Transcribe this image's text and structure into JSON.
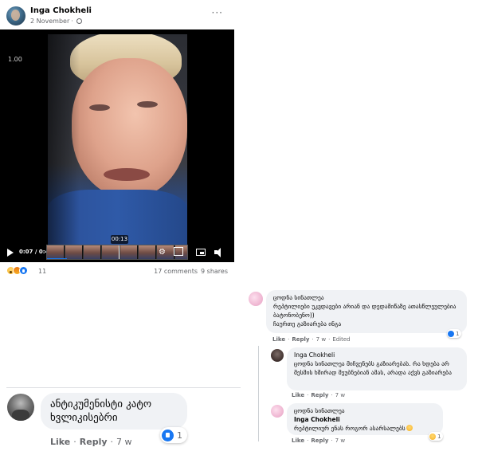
{
  "post": {
    "author": "Inga Chokheli",
    "date": "2 November",
    "separator": "·",
    "more": "···",
    "video": {
      "speed_label": "1.00",
      "preview_time": "00:13",
      "current_time": "0:07",
      "duration": "0:49",
      "time_separator": " / ",
      "progress_fraction": 0.14
    },
    "reactions_count": "11",
    "comments_label": "17 comments",
    "shares_label": "9 shares"
  },
  "left_comment": {
    "text": "ანტიკუმენისტი კატო ხვლიკისებრი",
    "like_label": "Like",
    "reply_label": "Reply",
    "time": "7 w",
    "separator": "·",
    "reaction_count": "1"
  },
  "thread": {
    "comment1": {
      "name": "ცოდნა სინათლეა",
      "text": "რეპტილიები უკვდავები არიან და დედამიწაზე ათასწლეულებია ბატონობენო))",
      "text2": "ჩაურთე გაზიარება ინგა",
      "like_label": "Like",
      "reply_label": "Reply",
      "time": "7 w",
      "edited": "Edited",
      "reaction_count": "1"
    },
    "comment2": {
      "name": "Inga Chokheli",
      "text": "ცოდნა სინათლეა მიჩვენებს გაზიარებას. რა ხდება არ მესმის ხშირად მეუბნებიან ამას, არადა აქვს გაზიარება",
      "like_label": "Like",
      "reply_label": "Reply",
      "time": "7 w"
    },
    "comment3": {
      "name": "ცოდნა სინათლეა",
      "mention": "Inga Chokheli",
      "text": "რეპტილიურ ენას როგორ ასარსალებს",
      "like_label": "Like",
      "reply_label": "Reply",
      "time": "7 w",
      "reaction_count": "1"
    }
  },
  "colors": {
    "accent": "#1877f2",
    "bubble": "#f0f2f5",
    "meta_text": "#65676b"
  },
  "icons": [
    "globe-icon",
    "more-icon",
    "play-icon",
    "settings-icon",
    "pip-icon",
    "volume-icon",
    "like-icon",
    "wow-icon",
    "angry-icon",
    "haha-icon"
  ]
}
